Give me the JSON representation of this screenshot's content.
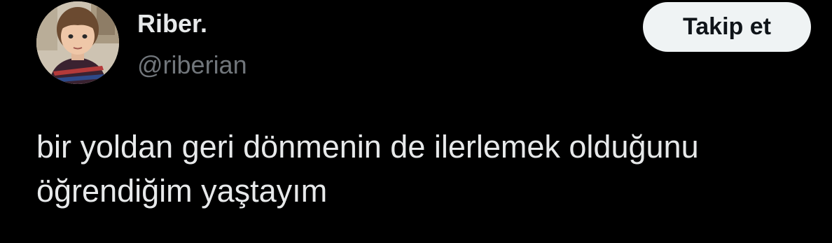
{
  "author": {
    "display_name": "Riber.",
    "handle": "@riberian",
    "avatar_icon": "child-photo-avatar"
  },
  "follow_button": {
    "label": "Takip et"
  },
  "tweet": {
    "lines": [
      "bir yoldan geri dönmenin de ilerlemek olduğunu",
      "öğrendiğim yaştayım"
    ]
  },
  "colors": {
    "background": "#000000",
    "primary_text": "#e7e9ea",
    "secondary_text": "#71767b",
    "button_bg": "#eff3f4",
    "button_text": "#0f1419"
  }
}
